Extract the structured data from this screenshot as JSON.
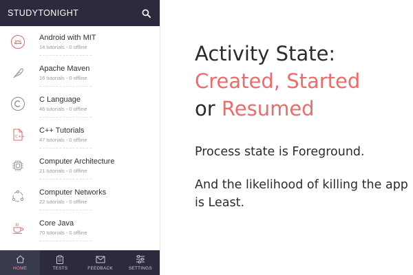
{
  "app": {
    "title": "STUDYTONIGHT",
    "search_icon": "search-icon"
  },
  "courses": [
    {
      "name": "Android with MIT",
      "meta": "14 tutorials - 0 offline",
      "icon": "android-icon"
    },
    {
      "name": "Apache Maven",
      "meta": "16 tutorials - 0 offline",
      "icon": "feather-icon"
    },
    {
      "name": "C Language",
      "meta": "46 tutorials - 0 offline",
      "icon": "c-letter-icon"
    },
    {
      "name": "C++ Tutorials",
      "meta": "47 tutorials - 0 offline",
      "icon": "cpp-file-icon"
    },
    {
      "name": "Computer Architecture",
      "meta": "21 tutorials - 0 offline",
      "icon": "chip-icon"
    },
    {
      "name": "Computer Networks",
      "meta": "22 tutorials - 0 offline",
      "icon": "network-icon"
    },
    {
      "name": "Core Java",
      "meta": "70 tutorials - 0 offline",
      "icon": "java-cup-icon"
    }
  ],
  "nav": [
    {
      "label": "HOME",
      "icon": "home-icon",
      "active": true
    },
    {
      "label": "TESTS",
      "icon": "clipboard-icon",
      "active": false
    },
    {
      "label": "FEEDBACK",
      "icon": "mail-icon",
      "active": false
    },
    {
      "label": "SETTINGS",
      "icon": "sliders-icon",
      "active": false
    }
  ],
  "slide": {
    "line1": "Activity State:",
    "line2": "Created, Started",
    "line3_prefix": "or ",
    "line3_accent": "Resumed",
    "paragraph1": "Process state is Foreground.",
    "paragraph2": "And the likelihood of killing the app is Least."
  },
  "colors": {
    "header_bg": "#2b2b3d",
    "accent": "#f06a6a",
    "icon_red": "#e56565",
    "icon_gray": "#8a8a94"
  }
}
